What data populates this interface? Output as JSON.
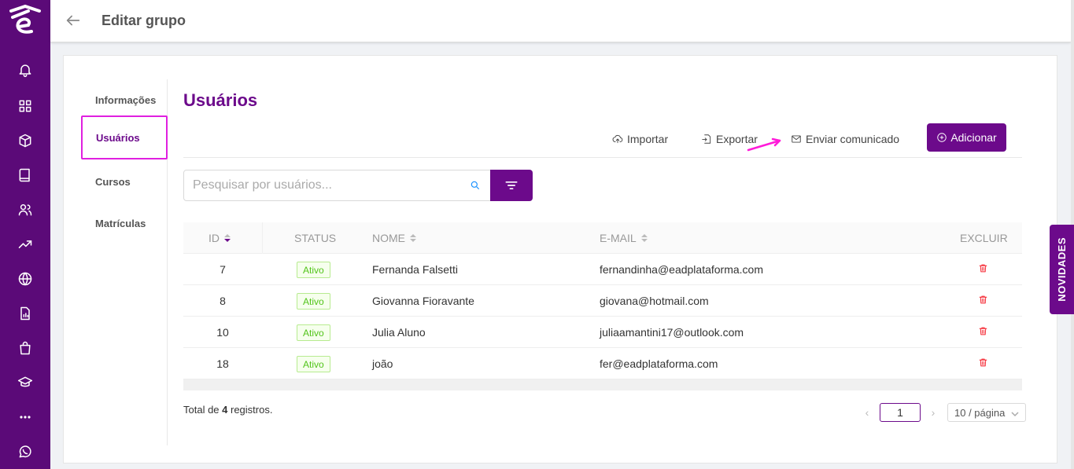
{
  "header": {
    "title": "Editar grupo"
  },
  "tabs": [
    {
      "label": "Informações"
    },
    {
      "label": "Usuários"
    },
    {
      "label": "Cursos"
    },
    {
      "label": "Matrículas"
    }
  ],
  "section": {
    "title": "Usuários"
  },
  "actions": {
    "import_label": "Importar",
    "export_label": "Exportar",
    "send_label": "Enviar comunicado",
    "add_label": "Adicionar"
  },
  "search": {
    "placeholder": "Pesquisar por usuários..."
  },
  "table": {
    "columns": {
      "id": "ID",
      "status": "STATUS",
      "name": "NOME",
      "email": "E-MAIL",
      "delete": "EXCLUIR"
    },
    "rows": [
      {
        "id": "7",
        "status": "Ativo",
        "name": "Fernanda Falsetti",
        "email": "fernandinha@eadplataforma.com"
      },
      {
        "id": "8",
        "status": "Ativo",
        "name": "Giovanna Fioravante",
        "email": "giovana@hotmail.com"
      },
      {
        "id": "10",
        "status": "Ativo",
        "name": "Julia Aluno",
        "email": "juliaamantini17@outlook.com"
      },
      {
        "id": "18",
        "status": "Ativo",
        "name": "joão",
        "email": "fer@eadplataforma.com"
      }
    ]
  },
  "footer": {
    "total_prefix": "Total de ",
    "total_count": "4",
    "total_suffix": " registros.",
    "page": "1",
    "page_size": "10 / página"
  },
  "side_tab": {
    "label": "NOVIDADES"
  },
  "colors": {
    "brand": "#6c0a8b",
    "rail": "#5b0a78",
    "active_badge": "#52c41a",
    "delete": "#f5222d",
    "highlight": "#e020e0"
  }
}
